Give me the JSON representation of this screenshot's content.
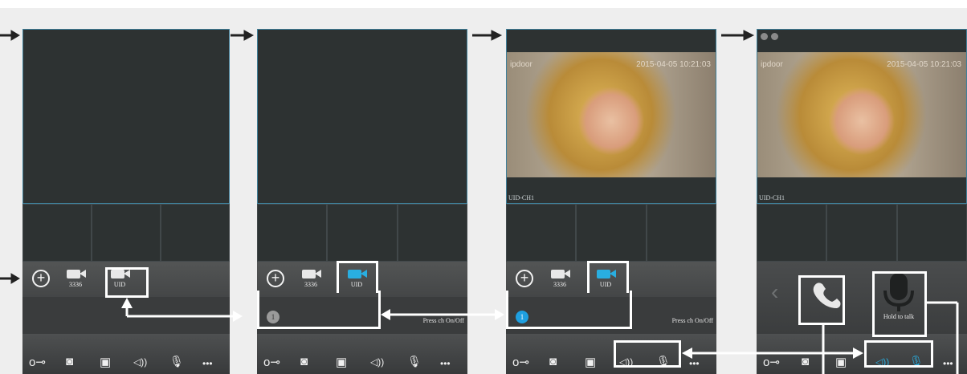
{
  "panels": [
    {
      "id": "p1",
      "add_label": "+",
      "cam1_label": "3336",
      "cam2_label": "UID",
      "chan_number": "",
      "press_label": ""
    },
    {
      "id": "p2",
      "add_label": "+",
      "cam1_label": "3336",
      "cam2_label": "UID",
      "chan_number": "1",
      "press_label": "Press ch On/Off"
    },
    {
      "id": "p3",
      "add_label": "+",
      "cam1_label": "3336",
      "cam2_label": "UID",
      "chan_number": "1",
      "press_label": "Press ch On/Off",
      "video_name": "ipdoor",
      "video_time": "2015-04-05 10:21:03",
      "uid_ch": "UID-CH1"
    },
    {
      "id": "p4",
      "video_name": "ipdoor",
      "video_time": "2015-04-05 10:21:03",
      "uid_ch": "UID-CH1",
      "back_glyph": "‹",
      "hold_label": "Hold to talk"
    }
  ],
  "toolbar_glyphs": {
    "key": "o⊸",
    "snapshot": "◙",
    "record": "▣",
    "speaker": "◁))",
    "mic": "🎙",
    "more": "•••"
  },
  "colors": {
    "accent": "#29aee0",
    "panel": "#2b2d2d",
    "highlight": "#ffffff"
  }
}
